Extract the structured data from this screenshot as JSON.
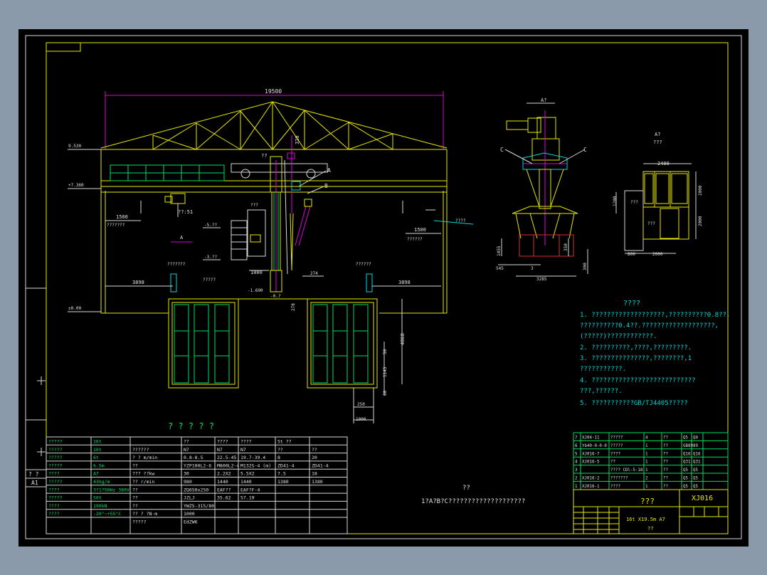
{
  "dims": {
    "span": "19500",
    "truss_h": "320",
    "left_clear": "1500",
    "right_clear": "1500",
    "left_3898": "3898",
    "right_3898": "3898",
    "mast_1000": "1000",
    "elev_4868": "4868",
    "d50": "50",
    "d1145": "1145",
    "d60": "60",
    "d250": "250",
    "d1000": "1000",
    "elev_top": "9.530",
    "elev_rail": "+7.360",
    "elev_floor": "±0.00",
    "elev_mid1": "-5.??",
    "elev_mid2": "-3.??",
    "elev_low": "-1.690",
    "elev_pit": "-0.?",
    "hook_label": "??:51",
    "mark_274": "274",
    "mark_278": "278",
    "cs_1455": "1455",
    "cs_350": "350",
    "cs_545": "545",
    "cs_3": "3",
    "cs_3285": "3285",
    "cs_300": "300",
    "pit_2400": "2400",
    "pit_2000a": "2000",
    "pit_2000b": "2000",
    "pit_2000c": "2000",
    "pit_1200": "1200",
    "pit_800": "800"
  },
  "labels": {
    "A": "A",
    "B": "B",
    "C_left": "C",
    "C_right": "C",
    "section_top": "A?",
    "view_label": "A?",
    "view_sub": "???",
    "trolley": "??",
    "q_left1": "???????",
    "q_left2": "???????",
    "q_left3": "??????",
    "q_mid1": "??????",
    "q_mid2": "?????",
    "q_right1": "????",
    "q_right2": "??????",
    "q_pit": "???",
    "q_pit2": "???"
  },
  "notes": {
    "title": "????",
    "lines": [
      "1. ???????????????????,??????????0.8??.",
      "   ??????????0.4??.???????????????????,",
      "   (?????)????????????.",
      "2. ??????????,????,?????????.",
      "3. ???????????????,????????,1",
      "   ???????????.",
      "4. ???????????????????????????",
      "   ???,??????.",
      "5. ???????????GB/TJ4405?????"
    ]
  },
  "params_title": "? ? ? ? ?",
  "params": [
    [
      "?????",
      "16t",
      "",
      "??",
      "????",
      "????",
      "5t ??",
      ""
    ],
    [
      "?????",
      "10t",
      "??????",
      "N7",
      "N7",
      "N7",
      "??",
      "??"
    ],
    [
      "?????",
      "6t",
      "? ?  m/min",
      "0.8-8.5",
      "22.5-45",
      "19.7-39.4",
      "8",
      "20"
    ],
    [
      "?????",
      "6.5m",
      "??",
      "YZP100L2-6",
      "M800L2-4",
      "M132S-4 (m)",
      "ZD41-4",
      "ZD41-4"
    ],
    [
      "????",
      "A7",
      "??? ??kw",
      "30",
      "2.2X2",
      "5.5X2",
      "7.5",
      "18"
    ],
    [
      "?????",
      "43kg/m",
      "??  r/min",
      "980",
      "1440",
      "1440",
      "1380",
      "1380"
    ],
    [
      "????",
      "3?1?50Hz 380V",
      "??",
      "ZQ650x250",
      "EAF??",
      "EAF?F-4",
      "",
      " "
    ],
    [
      "?????",
      "50t",
      "??",
      "JZLJ",
      "35.62",
      "57.19",
      "",
      ""
    ],
    [
      "????",
      "190kN",
      "??",
      "YWZ5-315/80",
      "",
      "",
      "",
      ""
    ],
    [
      "????",
      "-20°~+55°C",
      "?? ? ?N·m",
      "1000",
      "",
      "",
      "",
      ""
    ],
    [
      "",
      "",
      "?????",
      "EdZW6",
      "",
      "",
      "",
      ""
    ]
  ],
  "left_margin": [
    "? ?",
    "A1"
  ],
  "center_caption_1": "??",
  "center_caption_2": "1?A?B?C????????????????????",
  "bom": [
    [
      "7",
      "XJ04-11",
      "?????",
      "4",
      "??",
      "Q5",
      "Q0"
    ],
    [
      "6",
      "Yb40-0-0-0",
      "?????",
      "1",
      "??",
      "GB89",
      "89"
    ],
    [
      "5",
      "XJ016-7",
      "????",
      "1",
      "??",
      "Q16",
      "Q16"
    ],
    [
      "4",
      "XJ016-5",
      "??",
      "1",
      "??",
      "Q31",
      "Q31"
    ],
    [
      "3",
      "",
      "???? CDl-5-18",
      "1",
      "??",
      "Q5",
      "Q5"
    ],
    [
      "2",
      "XJ016-2",
      "???????",
      "2",
      "??",
      "Q5",
      "Q5"
    ],
    [
      "1",
      "XJ016-1",
      "????",
      "1",
      "??",
      "Q5",
      "Q5"
    ]
  ],
  "title_block": {
    "drawing_no": "XJ016",
    "name": "???",
    "spec": "16t X19.5m  A7",
    "sub": "??"
  }
}
